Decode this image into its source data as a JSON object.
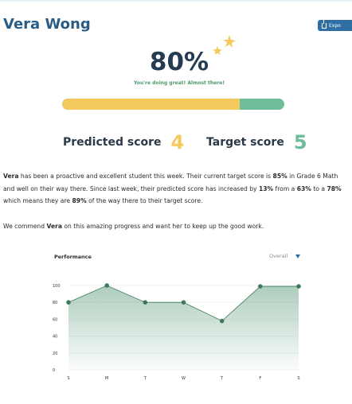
{
  "student": {
    "name": "Vera Wong"
  },
  "toolbar": {
    "export_label": "Expo"
  },
  "progress": {
    "percent_label": "80%",
    "percent_value": 0.8,
    "message": "You're doing great! Almost there!"
  },
  "scores": {
    "predicted_label": "Predicted score",
    "predicted_value": "4",
    "target_label": "Target score",
    "target_value": "5"
  },
  "summary": {
    "p1_name": "Vera",
    "p1_a": " has been a proactive and excellent student this week. Their current target score is ",
    "p1_target_pct": "85%",
    "p1_b": " in Grade 6 Math and well on their way there. Since last week, their predicted score has increased by ",
    "p1_increase": "13%",
    "p1_c": " from a ",
    "p1_from": "63%",
    "p1_d": " to a ",
    "p1_to": "78%",
    "p1_e": " which means they are ",
    "p1_of": "89%",
    "p1_f": " of the way there to their target score.",
    "p2_a": "We commend ",
    "p2_name": "Vera",
    "p2_b": " on this amazing progress and want her to keep up the good work."
  },
  "chart_panel": {
    "title": "Performance",
    "filter_value": "Overall"
  },
  "colors": {
    "primary": "#2a5d86",
    "yellow": "#f4c95d",
    "green": "#6dbc9a",
    "chart_line": "#3f7a5a"
  },
  "chart_data": {
    "type": "area",
    "title": "Performance",
    "categories": [
      "S",
      "M",
      "T",
      "W",
      "T",
      "F",
      "S"
    ],
    "values": [
      80,
      100,
      80,
      80,
      58,
      99,
      99
    ],
    "y_ticks": [
      "100",
      "80",
      "60",
      "40",
      "20",
      "0"
    ],
    "ylim": [
      0,
      100
    ],
    "grid": true
  }
}
